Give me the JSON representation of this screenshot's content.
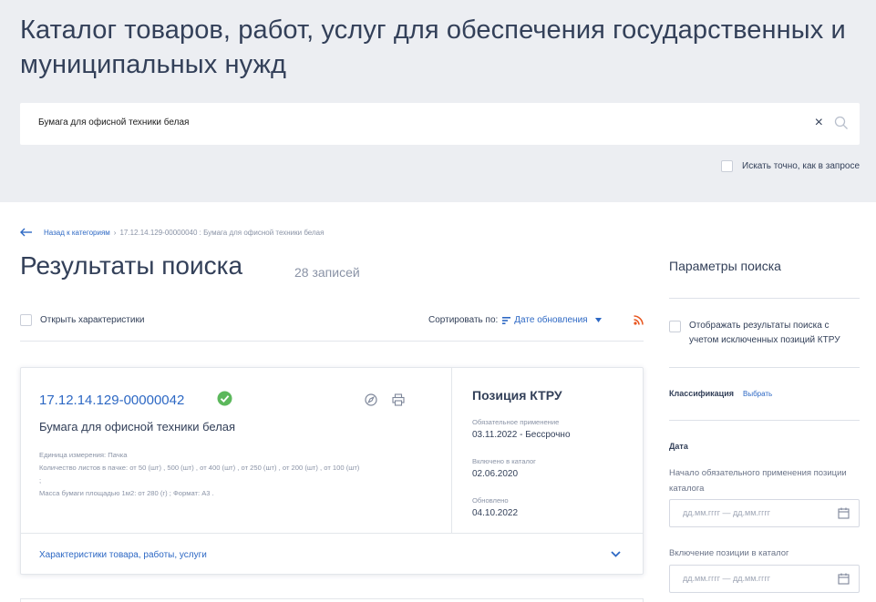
{
  "header": {
    "title": "Каталог товаров, работ, услуг для обеспечения государственных и муниципальных нужд",
    "search_value": "Бумага для офисной техники белая",
    "clear_symbol": "×",
    "exact_search_label": "Искать точно, как в запросе"
  },
  "breadcrumb": {
    "back_label": "Назад к категориям",
    "separator": "›",
    "current": "17.12.14.129-00000040 : Бумага для офисной техники белая"
  },
  "results": {
    "title": "Результаты поиска",
    "count": "28 записей",
    "open_characteristics_label": "Открыть характеристики",
    "sort_prefix": "Сортировать по:",
    "sort_value": "Дате обновления"
  },
  "card": {
    "code": "17.12.14.129-00000042",
    "name": "Бумага для офисной техники белая",
    "details": [
      "Единица измерения: Пачка",
      "Количество листов в пачке: от 50 (шт) , 500 (шт) , от 400 (шт) , от 250 (шт) , от 200 (шт) , от 100 (шт)",
      ";",
      "Масса бумаги площадью 1м2: от 280 (г) ; Формат: A3 ."
    ],
    "ktru_title": "Позиция КТРУ",
    "mandatory_label": "Обязательное применение",
    "mandatory_value": "03.11.2022 - Бессрочно",
    "included_label": "Включено в каталог",
    "included_value": "02.06.2020",
    "updated_label": "Обновлено",
    "updated_value": "04.10.2022",
    "footer_label": "Характеристики товара, работы, услуги"
  },
  "sidebar": {
    "title": "Параметры поиска",
    "excluded_label": "Отображать результаты поиска с учетом исключенных позиций КТРУ",
    "classification_label": "Классификация",
    "classification_link": "Выбрать",
    "date_title": "Дата",
    "mandatory_start_label": "Начало обязательного применения позиции каталога",
    "inclusion_label": "Включение позиции в каталог",
    "date_placeholder": "дд.мм.гггг — дд.мм.гггг"
  },
  "colors": {
    "header_bg": "#eceef2",
    "text": "#334059",
    "link": "#2d68c4",
    "muted": "#8a93a6",
    "check_green": "#5cb85c",
    "rss_orange": "#e8551e"
  },
  "icons": [
    "back-arrow-icon",
    "search-icon",
    "close-icon",
    "filter-sort-icon",
    "caret-down-icon",
    "rss-icon",
    "check-circle-icon",
    "compass-icon",
    "print-icon",
    "chevron-down-icon",
    "calendar-icon"
  ]
}
